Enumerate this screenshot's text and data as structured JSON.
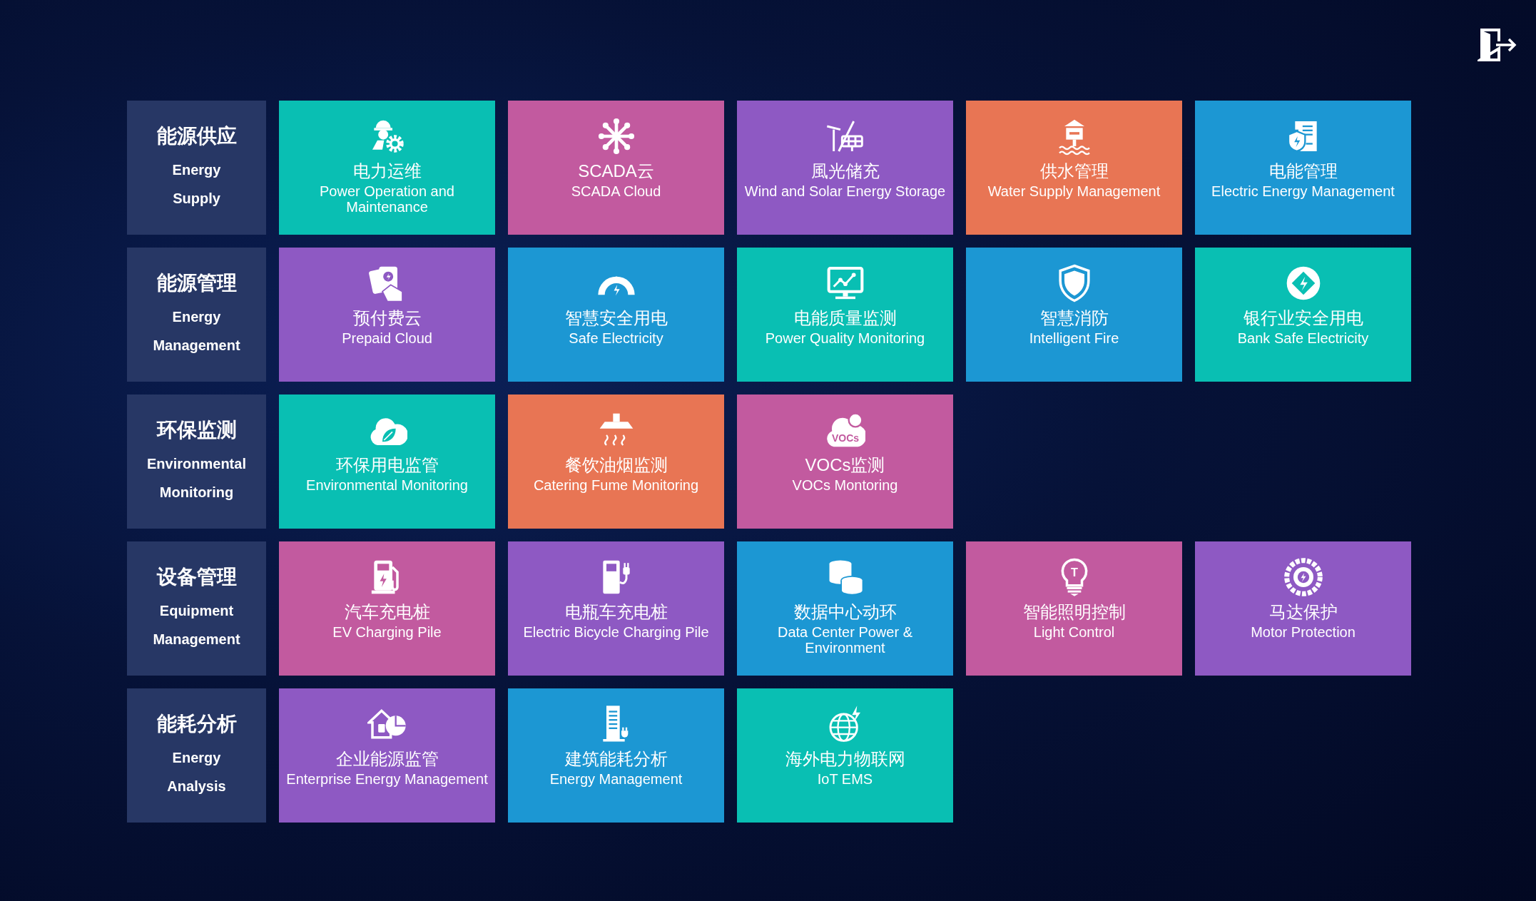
{
  "rows": [
    {
      "category": {
        "zh": "能源供应",
        "en": [
          "Energy",
          "Supply"
        ]
      },
      "tiles": [
        {
          "zh": "电力运维",
          "en": "Power Operation and Maintenance",
          "color": "#09bfb3"
        },
        {
          "zh": "SCADA云",
          "en": "SCADA Cloud",
          "color": "#c25a9f"
        },
        {
          "zh": "風光储充",
          "en": "Wind and Solar Energy Storage",
          "color": "#8e59c3"
        },
        {
          "zh": "供水管理",
          "en": "Water Supply Management",
          "color": "#e87554"
        },
        {
          "zh": "电能管理",
          "en": "Electric Energy Management",
          "color": "#1c97d3"
        }
      ]
    },
    {
      "category": {
        "zh": "能源管理",
        "en": [
          "Energy",
          "Management"
        ]
      },
      "tiles": [
        {
          "zh": "预付费云",
          "en": "Prepaid Cloud",
          "color": "#8e59c3"
        },
        {
          "zh": "智慧安全用电",
          "en": "Safe Electricity",
          "color": "#1c97d3"
        },
        {
          "zh": "电能质量监测",
          "en": "Power Quality Monitoring",
          "color": "#09bfb3"
        },
        {
          "zh": "智慧消防",
          "en": "Intelligent Fire",
          "color": "#1c97d3"
        },
        {
          "zh": "银行业安全用电",
          "en": "Bank Safe Electricity",
          "color": "#09bfb3"
        }
      ]
    },
    {
      "category": {
        "zh": "环保监测",
        "en": [
          "Environmental",
          "Monitoring"
        ]
      },
      "tiles": [
        {
          "zh": "环保用电监管",
          "en": "Environmental Monitoring",
          "color": "#09bfb3"
        },
        {
          "zh": "餐饮油烟监测",
          "en": "Catering Fume Monitoring",
          "color": "#e87554"
        },
        {
          "zh": "VOCs监测",
          "en": "VOCs Montoring",
          "color": "#c25a9f",
          "icon_text": "VOCs"
        }
      ]
    },
    {
      "category": {
        "zh": "设备管理",
        "en": [
          "Equipment",
          "Management"
        ]
      },
      "tiles": [
        {
          "zh": "汽车充电桩",
          "en": "EV Charging Pile",
          "color": "#c25a9f"
        },
        {
          "zh": "电瓶车充电桩",
          "en": "Electric Bicycle Charging Pile",
          "color": "#8e59c3"
        },
        {
          "zh": "数据中心动环",
          "en": "Data Center Power & Environment",
          "color": "#1c97d3"
        },
        {
          "zh": "智能照明控制",
          "en": "Light Control",
          "color": "#c25a9f",
          "icon_text": "T"
        },
        {
          "zh": "马达保护",
          "en": "Motor Protection",
          "color": "#8e59c3"
        }
      ]
    },
    {
      "category": {
        "zh": "能耗分析",
        "en": [
          "Energy",
          "Analysis"
        ]
      },
      "tiles": [
        {
          "zh": "企业能源监管",
          "en": "Enterprise Energy Management",
          "color": "#8e59c3"
        },
        {
          "zh": "建筑能耗分析",
          "en": "Energy Management",
          "color": "#1c97d3"
        },
        {
          "zh": "海外电力物联网",
          "en": "IoT EMS",
          "color": "#09bfb3"
        }
      ]
    }
  ]
}
